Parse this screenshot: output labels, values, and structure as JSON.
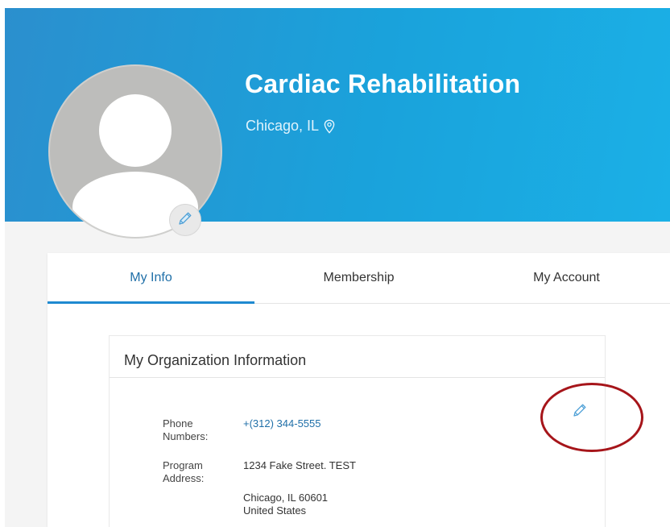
{
  "header": {
    "title": "Cardiac Rehabilitation",
    "location": "Chicago, IL",
    "location_icon": "map-pin-icon",
    "avatar_icon": "user-silhouette-icon",
    "avatar_edit_icon": "pencil-icon"
  },
  "tabs": [
    {
      "label": "My Info",
      "active": true
    },
    {
      "label": "Membership",
      "active": false
    },
    {
      "label": "My Account",
      "active": false
    }
  ],
  "organization": {
    "title": "My Organization Information",
    "edit_icon": "pencil-icon",
    "phone_label": "Phone Numbers:",
    "phone_value": "+(312) 344-5555",
    "address_label": "Program Address:",
    "address_line1": "1234 Fake Street. TEST",
    "address_line2": "Chicago, IL 60601",
    "address_line3": "United States"
  },
  "colors": {
    "brand_blue": "#1aa2db",
    "link_blue": "#1f6fa8",
    "annotation_red": "#a6151a"
  }
}
